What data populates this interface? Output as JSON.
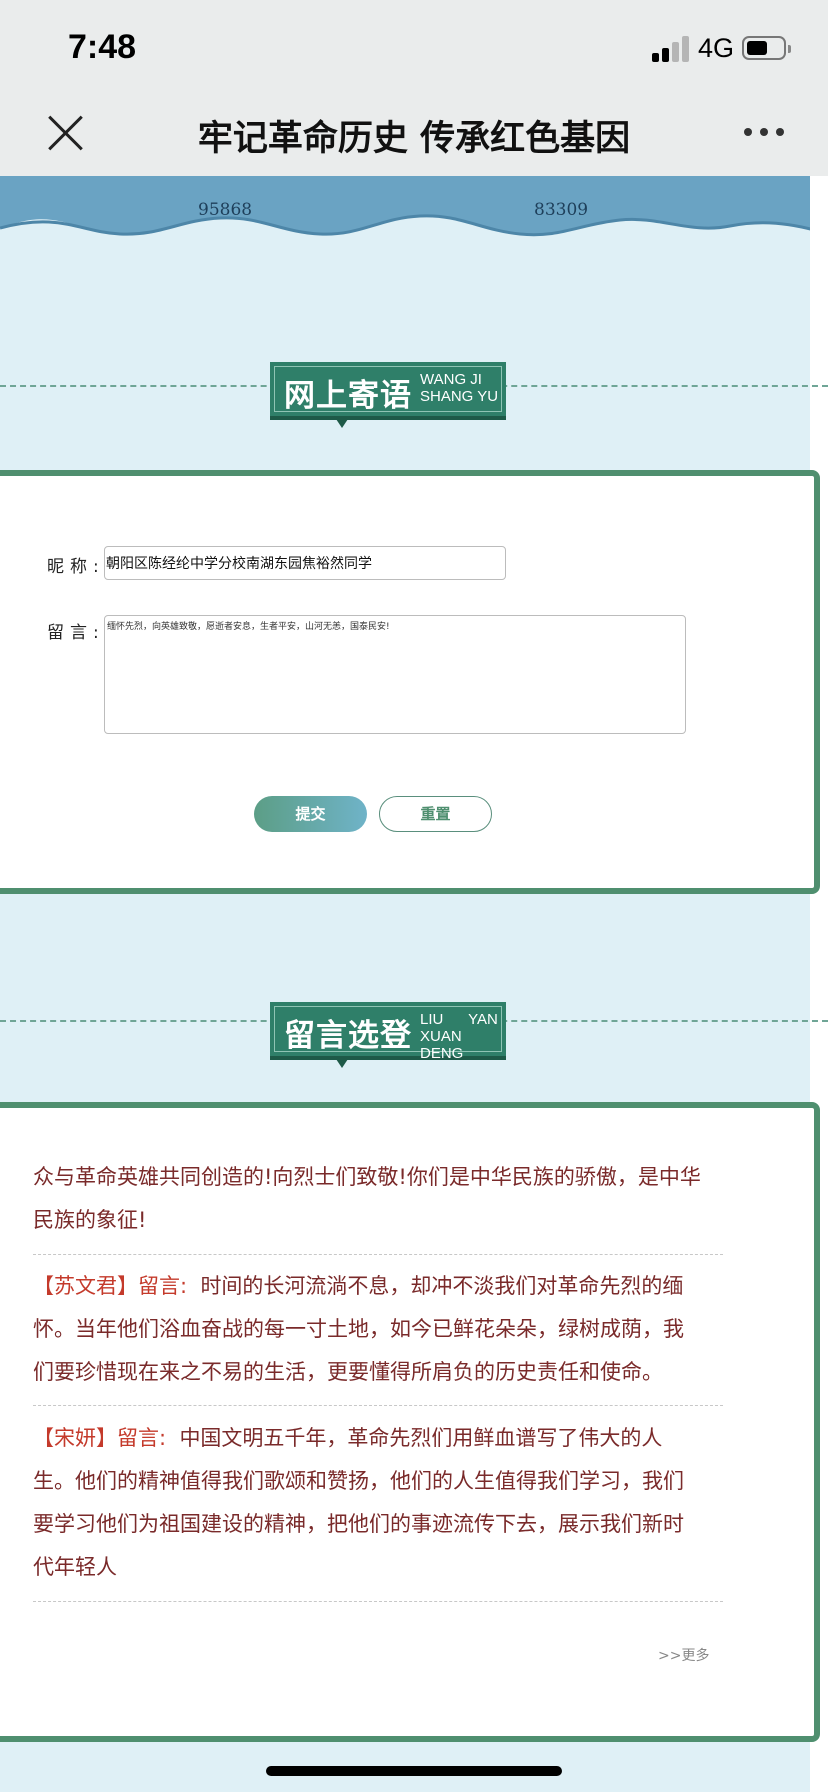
{
  "status_bar": {
    "time": "7:48",
    "network": "4G"
  },
  "nav": {
    "title": "牢记革命历史 传承红色基因"
  },
  "banner": {
    "count_left": "95868",
    "count_right": "83309"
  },
  "guestbook": {
    "heading_cn": "网上寄语",
    "heading_en_line1": "WANG JI",
    "heading_en_line2": "SHANG YU",
    "nickname_label": "昵称:",
    "nickname_value": "朝阳区陈经纶中学分校南湖东园焦裕然同学",
    "message_label": "留言:",
    "message_value": "缅怀先烈，向英雄致敬，愿逝者安息，生者平安，山河无恙，国泰民安!",
    "submit_label": "提交",
    "reset_label": "重置"
  },
  "selected": {
    "heading_cn": "留言选登",
    "heading_en_line1": "LIU      YAN",
    "heading_en_line2": "XUAN DENG",
    "messages": [
      {
        "name": "",
        "lines": [
          "众与革命英雄共同创造的!向烈士们致敬!你们是中华民族的骄傲，是中华",
          "民族的象征!"
        ]
      },
      {
        "name": "【苏文君】留言:",
        "lines": [
          "时间的长河流淌不息，却冲不淡我们对革命先烈的缅",
          "怀。当年他们浴血奋战的每一寸土地，如今已鲜花朵朵，绿树成荫，我",
          "们要珍惜现在来之不易的生活，更要懂得所肩负的历史责任和使命。"
        ]
      },
      {
        "name": "【宋妍】留言:",
        "lines": [
          "中国文明五千年，革命先烈们用鲜血谱写了伟大的人",
          "生。他们的精神值得我们歌颂和赞扬，他们的人生值得我们学习，我们",
          "要学习他们为祖国建设的精神，把他们的事迹流传下去，展示我们新时",
          "代年轻人"
        ]
      }
    ],
    "more_label": ">>更多"
  },
  "icons": [
    "close-icon",
    "more-icon",
    "signal-icon",
    "battery-icon"
  ]
}
